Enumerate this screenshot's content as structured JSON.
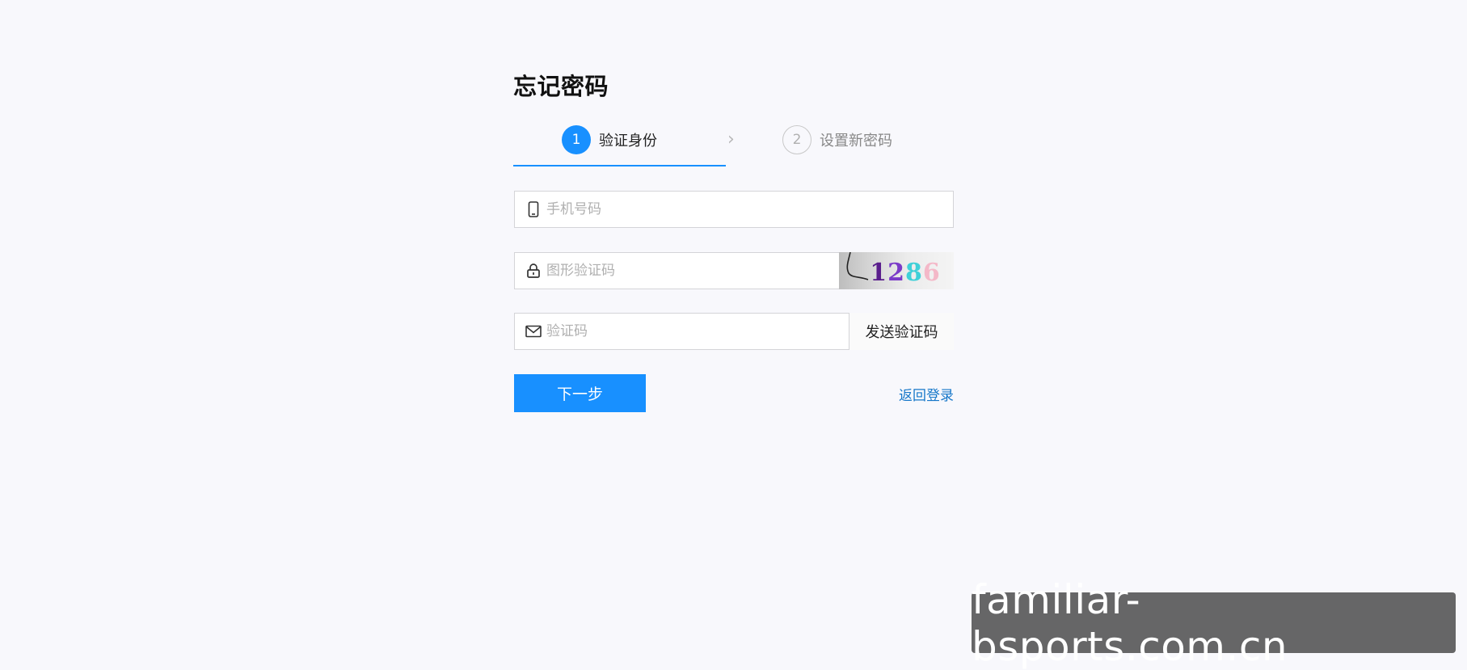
{
  "page": {
    "title": "忘记密码"
  },
  "steps": [
    {
      "number": "1",
      "label": "验证身份",
      "state": "active"
    },
    {
      "number": "2",
      "label": "设置新密码",
      "state": "inactive"
    }
  ],
  "step_arrow": "›",
  "form": {
    "phone": {
      "placeholder": "手机号码",
      "value": "",
      "icon": "phone-icon"
    },
    "captcha": {
      "placeholder": "图形验证码",
      "value": "",
      "icon": "lock-icon",
      "image_text": [
        "1",
        "2",
        "8",
        "6"
      ]
    },
    "code": {
      "placeholder": "验证码",
      "value": "",
      "icon": "mail-icon"
    },
    "send_code_label": "发送验证码"
  },
  "actions": {
    "next_label": "下一步",
    "back_login_label": "返回登录"
  },
  "watermark": "familiar-bsports.com.cn",
  "colors": {
    "primary": "#1890ff",
    "link": "#1677c9",
    "background": "#f8f8fc"
  }
}
